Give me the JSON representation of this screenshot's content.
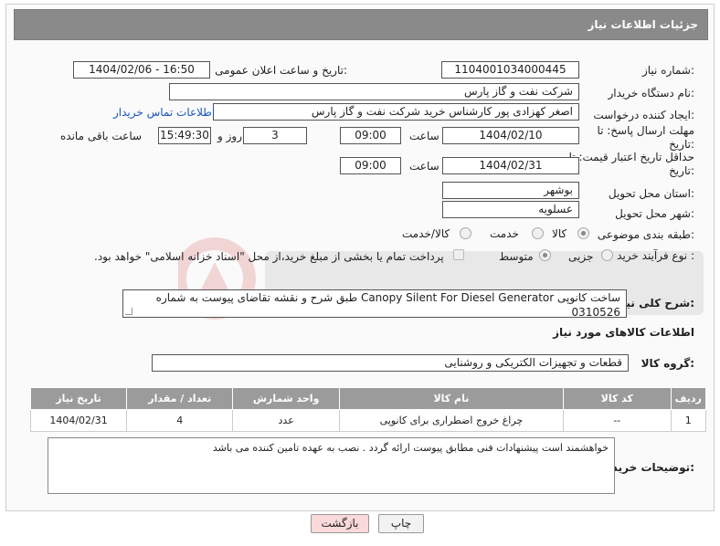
{
  "header": {
    "title": "جزئیات اطلاعات نیاز"
  },
  "fields": {
    "need_number_label": "شماره نیاز:",
    "need_number": "1104001034000445",
    "announce_label": "تاریخ و ساعت اعلان عمومی:",
    "announce_value": "1404/02/06 - 16:50",
    "buyer_label": "نام دستگاه خریدار:",
    "buyer_value": "شرکت نفت و گاز پارس",
    "creator_label": "ایجاد کننده درخواست:",
    "creator_value": "اصغر کهزادی پور کارشناس خرید شرکت نفت و گاز پارس",
    "contact_link": "اطلاعات تماس خریدار",
    "deadline_label": "مهلت ارسال پاسخ: تا تاریخ:",
    "deadline_date": "1404/02/10",
    "time_label": "ساعت",
    "deadline_time": "09:00",
    "days_value": "3",
    "days_label": "روز و",
    "remaining_time": "15:49:30",
    "remaining_label": "ساعت باقی مانده",
    "min_validity_label": "حداقل تاریخ اعتبار قیمت: تا تاریخ:",
    "validity_date": "1404/02/31",
    "validity_time": "09:00",
    "province_label": "استان محل تحویل:",
    "province_value": "بوشهر",
    "city_label": "شهر محل تحویل:",
    "city_value": "عسلویه",
    "category_label": "طبقه بندی موضوعی:",
    "category_options": [
      "کالا",
      "خدمت",
      "کالا/خدمت"
    ],
    "purchase_label": "نوع فرآیند خرید :",
    "purchase_options": [
      "جزیی",
      "متوسط"
    ],
    "payment_text": "پرداخت تمام یا بخشی از مبلغ خرید،از محل \"اسناد خزانه اسلامی\" خواهد بود.",
    "desc_label": "شرح کلی نیاز:",
    "desc_value": "ساخت کانوپی Canopy Silent For Diesel Generator طبق شرح و نقشه تقاضای پیوست به شماره 0310526",
    "goods_info_title": "اطلاعات کالاهای مورد نیاز",
    "group_label": "گروه کالا:",
    "group_value": "قطعات و تجهیزات الکتریکی و روشنایی",
    "buyer_notes_label": "توضیحات خریدار:",
    "buyer_notes": "خواهشمند است پیشنهادات فنی مطابق پیوست ارائه گردد . نصب به عهده تامین کننده می باشد"
  },
  "table": {
    "headers": [
      "ردیف",
      "کد کالا",
      "نام کالا",
      "واحد شمارش",
      "تعداد / مقدار",
      "تاریخ نیاز"
    ],
    "rows": [
      [
        "1",
        "--",
        "چراغ خروج اضطراری برای کانوپی",
        "عدد",
        "4",
        "1404/02/31"
      ]
    ]
  },
  "buttons": {
    "print": "چاپ",
    "back": "بازگشت"
  },
  "colors": {
    "header_bg": "#8a8a8a",
    "link": "#1a56c0",
    "back_button_bg": "#f9d9d9"
  }
}
